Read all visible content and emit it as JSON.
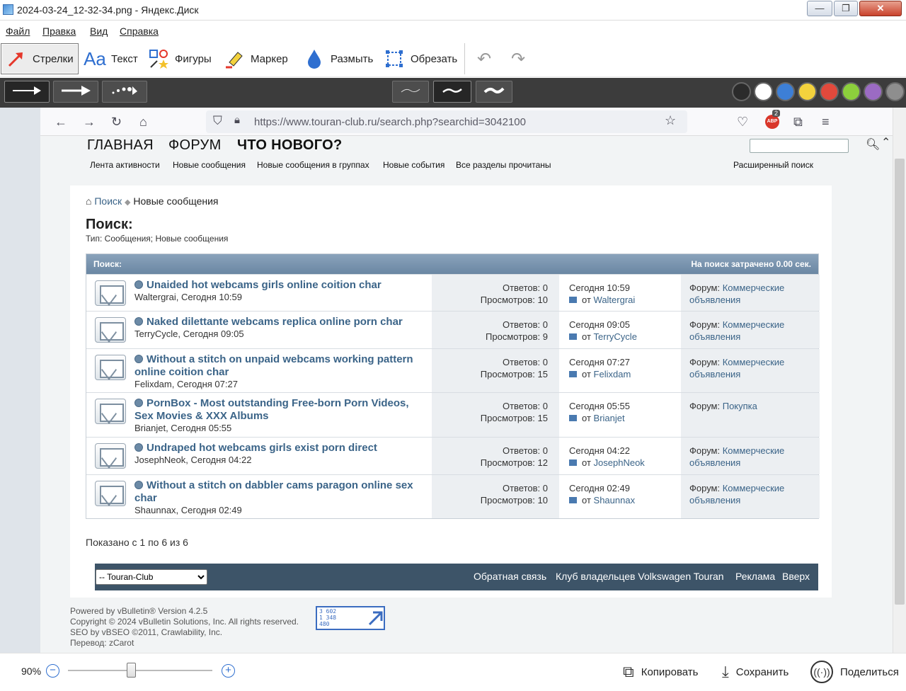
{
  "window": {
    "title": "2024-03-24_12-32-34.png - Яндекс.Диск",
    "minimize": "—",
    "maximize": "❐",
    "close": "✕"
  },
  "menu": [
    "Файл",
    "Правка",
    "Вид",
    "Справка"
  ],
  "tools": [
    {
      "label": "Стрелки",
      "icon": "arrow-icon",
      "active": true
    },
    {
      "label": "Текст",
      "icon": "text-icon"
    },
    {
      "label": "Фигуры",
      "icon": "shapes-icon"
    },
    {
      "label": "Маркер",
      "icon": "marker-icon"
    },
    {
      "label": "Размыть",
      "icon": "blur-icon"
    },
    {
      "label": "Обрезать",
      "icon": "crop-icon"
    }
  ],
  "colors": [
    "#2b2b2b",
    "#ffffff",
    "#3d7fd6",
    "#f3d23d",
    "#e2493c",
    "#8ccf3c",
    "#9b6bc3",
    "#8e8e8e"
  ],
  "browser": {
    "url": "https://www.touran-club.ru/search.php?searchid=3042100",
    "abp_badge": "2"
  },
  "forum": {
    "nav_main": [
      "ГЛАВНАЯ",
      "ФОРУМ",
      "ЧТО НОВОГО?"
    ],
    "nav_sub": [
      "Лента активности",
      "Новые сообщения",
      "Новые сообщения в группах",
      "Новые события",
      "Все разделы прочитаны"
    ],
    "advanced_search": "Расширенный поиск",
    "breadcrumb_link": "Поиск",
    "breadcrumb_current": "Новые сообщения",
    "heading": "Поиск:",
    "subheading": "Тип: Сообщения; Новые сообщения",
    "table_title": "Поиск:",
    "table_time": "На поиск затрачено 0.00 сек.",
    "rows": [
      {
        "title": "Unaided hot webcams girls online coition char",
        "by": "Waltergrai, Сегодня 10:59",
        "replies": "Ответов: 0",
        "views": "Просмотров: 10",
        "last_time": "Сегодня 10:59",
        "last_by_prefix": "от",
        "last_by": "Waltergrai",
        "forum_prefix": "Форум:",
        "forum": "Коммерческие объявления"
      },
      {
        "title": "Naked dilettante webcams replica online porn char",
        "by": "TerryCycle, Сегодня 09:05",
        "replies": "Ответов: 0",
        "views": "Просмотров: 9",
        "last_time": "Сегодня 09:05",
        "last_by_prefix": "от",
        "last_by": "TerryCycle",
        "forum_prefix": "Форум:",
        "forum": "Коммерческие объявления"
      },
      {
        "title": "Without a stitch on unpaid webcams working pattern online coition char",
        "by": "Felixdam, Сегодня 07:27",
        "replies": "Ответов: 0",
        "views": "Просмотров: 15",
        "last_time": "Сегодня 07:27",
        "last_by_prefix": "от",
        "last_by": "Felixdam",
        "forum_prefix": "Форум:",
        "forum": "Коммерческие объявления"
      },
      {
        "title": "PornBox - Most outstanding Free-born Porn Videos, Sex Movies & XXX Albums",
        "by": "Brianjet, Сегодня 05:55",
        "replies": "Ответов: 0",
        "views": "Просмотров: 15",
        "last_time": "Сегодня 05:55",
        "last_by_prefix": "от",
        "last_by": "Brianjet",
        "forum_prefix": "Форум:",
        "forum": "Покупка"
      },
      {
        "title": "Undraped hot webcams girls exist porn direct",
        "by": "JosephNeok, Сегодня 04:22",
        "replies": "Ответов: 0",
        "views": "Просмотров: 12",
        "last_time": "Сегодня 04:22",
        "last_by_prefix": "от",
        "last_by": "JosephNeok",
        "forum_prefix": "Форум:",
        "forum": "Коммерческие объявления"
      },
      {
        "title": "Without a stitch on dabbler cams paragon online sex char",
        "by": "Shaunnax, Сегодня 02:49",
        "replies": "Ответов: 0",
        "views": "Просмотров: 10",
        "last_time": "Сегодня 02:49",
        "last_by_prefix": "от",
        "last_by": "Shaunnax",
        "forum_prefix": "Форум:",
        "forum": "Коммерческие объявления"
      }
    ],
    "shown": "Показано с 1 по 6 из 6",
    "style_select": "-- Touran-Club",
    "footer_links": [
      "Обратная связь",
      "Клуб владельцев Volkswagen Touran",
      "Реклама",
      "Вверх"
    ],
    "copyright": [
      "Powered by vBulletin® Version 4.2.5",
      "Copyright © 2024 vBulletin Solutions, Inc. All rights reserved.",
      "SEO by vBSEO ©2011, Crawlability, Inc.",
      "Перевод: zCarot"
    ],
    "counter": [
      "3 602",
      "1 348",
      "480"
    ]
  },
  "bottom": {
    "zoom": "90%",
    "zoom_out": "−",
    "zoom_in": "+",
    "copy": "Копировать",
    "save": "Сохранить",
    "share": "Поделиться"
  }
}
